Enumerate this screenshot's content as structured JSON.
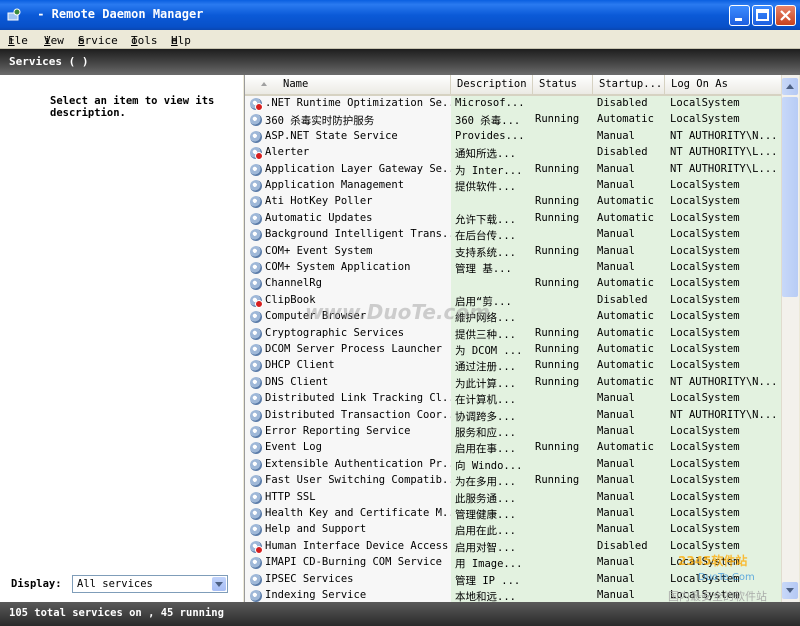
{
  "window": {
    "title": " - Remote Daemon Manager",
    "icon": "app-icon"
  },
  "menu": [
    {
      "u": "F",
      "rest": "ile"
    },
    {
      "u": "V",
      "rest": "iew"
    },
    {
      "u": "S",
      "rest": "ervice"
    },
    {
      "u": "T",
      "rest": "ools"
    },
    {
      "u": "H",
      "rest": "elp"
    }
  ],
  "banner": {
    "title": "Services ( )"
  },
  "left": {
    "description": "Select an item to view its description.",
    "display_label": "Display:",
    "display_value": "All services"
  },
  "columns": [
    "Name",
    "Description",
    "Status",
    "Startup...",
    "Log On As"
  ],
  "rows": [
    {
      "icon": "stop",
      "name": ".NET Runtime Optimization Se...",
      "desc": "Microsof...",
      "status": "",
      "startup": "Disabled",
      "logon": "LocalSystem"
    },
    {
      "icon": "gear",
      "name": "360 杀毒实时防护服务",
      "desc": "360 杀毒...",
      "status": "Running",
      "startup": "Automatic",
      "logon": "LocalSystem"
    },
    {
      "icon": "gear",
      "name": "ASP.NET State Service",
      "desc": "Provides...",
      "status": "",
      "startup": "Manual",
      "logon": "NT AUTHORITY\\N..."
    },
    {
      "icon": "stop",
      "name": "Alerter",
      "desc": "通知所选...",
      "status": "",
      "startup": "Disabled",
      "logon": "NT AUTHORITY\\L..."
    },
    {
      "icon": "gear",
      "name": "Application Layer Gateway Se...",
      "desc": "为 Inter...",
      "status": "Running",
      "startup": "Manual",
      "logon": "NT AUTHORITY\\L..."
    },
    {
      "icon": "gear",
      "name": "Application Management",
      "desc": "提供软件...",
      "status": "",
      "startup": "Manual",
      "logon": "LocalSystem"
    },
    {
      "icon": "gear",
      "name": "Ati HotKey Poller",
      "desc": "",
      "status": "Running",
      "startup": "Automatic",
      "logon": "LocalSystem"
    },
    {
      "icon": "gear",
      "name": "Automatic Updates",
      "desc": "允许下载...",
      "status": "Running",
      "startup": "Automatic",
      "logon": "LocalSystem"
    },
    {
      "icon": "gear",
      "name": "Background Intelligent Trans...",
      "desc": "在后台传...",
      "status": "",
      "startup": "Manual",
      "logon": "LocalSystem"
    },
    {
      "icon": "gear",
      "name": "COM+ Event System",
      "desc": "支持系统...",
      "status": "Running",
      "startup": "Manual",
      "logon": "LocalSystem"
    },
    {
      "icon": "gear",
      "name": "COM+ System Application",
      "desc": "管理 基...",
      "status": "",
      "startup": "Manual",
      "logon": "LocalSystem"
    },
    {
      "icon": "gear",
      "name": "ChannelRg",
      "desc": "",
      "status": "Running",
      "startup": "Automatic",
      "logon": "LocalSystem"
    },
    {
      "icon": "stop",
      "name": "ClipBook",
      "desc": "启用“剪...",
      "status": "",
      "startup": "Disabled",
      "logon": "LocalSystem"
    },
    {
      "icon": "gear",
      "name": "Computer Browser",
      "desc": "維护网络...",
      "status": "",
      "startup": "Automatic",
      "logon": "LocalSystem"
    },
    {
      "icon": "gear",
      "name": "Cryptographic Services",
      "desc": "提供三种...",
      "status": "Running",
      "startup": "Automatic",
      "logon": "LocalSystem"
    },
    {
      "icon": "gear",
      "name": "DCOM Server Process Launcher",
      "desc": "为 DCOM ...",
      "status": "Running",
      "startup": "Automatic",
      "logon": "LocalSystem"
    },
    {
      "icon": "gear",
      "name": "DHCP Client",
      "desc": "通过注册...",
      "status": "Running",
      "startup": "Automatic",
      "logon": "LocalSystem"
    },
    {
      "icon": "gear",
      "name": "DNS Client",
      "desc": "为此计算...",
      "status": "Running",
      "startup": "Automatic",
      "logon": "NT AUTHORITY\\N..."
    },
    {
      "icon": "gear",
      "name": "Distributed Link Tracking Cl...",
      "desc": "在计算机...",
      "status": "",
      "startup": "Manual",
      "logon": "LocalSystem"
    },
    {
      "icon": "gear",
      "name": "Distributed Transaction Coor...",
      "desc": "协调跨多...",
      "status": "",
      "startup": "Manual",
      "logon": "NT AUTHORITY\\N..."
    },
    {
      "icon": "gear",
      "name": "Error Reporting Service",
      "desc": "服务和应...",
      "status": "",
      "startup": "Manual",
      "logon": "LocalSystem"
    },
    {
      "icon": "gear",
      "name": "Event Log",
      "desc": "启用在事...",
      "status": "Running",
      "startup": "Automatic",
      "logon": "LocalSystem"
    },
    {
      "icon": "gear",
      "name": "Extensible Authentication Pr...",
      "desc": "向 Windo...",
      "status": "",
      "startup": "Manual",
      "logon": "LocalSystem"
    },
    {
      "icon": "gear",
      "name": "Fast User Switching Compatib...",
      "desc": "为在多用...",
      "status": "Running",
      "startup": "Manual",
      "logon": "LocalSystem"
    },
    {
      "icon": "gear",
      "name": "HTTP SSL",
      "desc": "此服务通...",
      "status": "",
      "startup": "Manual",
      "logon": "LocalSystem"
    },
    {
      "icon": "gear",
      "name": "Health Key and Certificate M...",
      "desc": "管理健康...",
      "status": "",
      "startup": "Manual",
      "logon": "LocalSystem"
    },
    {
      "icon": "gear",
      "name": "Help and Support",
      "desc": "启用在此...",
      "status": "",
      "startup": "Manual",
      "logon": "LocalSystem"
    },
    {
      "icon": "stop",
      "name": "Human Interface Device Access",
      "desc": "启用对智...",
      "status": "",
      "startup": "Disabled",
      "logon": "LocalSystem"
    },
    {
      "icon": "gear",
      "name": "IMAPI CD-Burning COM Service",
      "desc": "用 Image...",
      "status": "",
      "startup": "Manual",
      "logon": "LocalSystem"
    },
    {
      "icon": "gear",
      "name": "IPSEC Services",
      "desc": "管理 IP ...",
      "status": "",
      "startup": "Manual",
      "logon": "LocalSystem"
    },
    {
      "icon": "gear",
      "name": "Indexing Service",
      "desc": "本地和远...",
      "status": "",
      "startup": "Manual",
      "logon": "LocalSystem"
    }
  ],
  "status": {
    "text": "105 total services on , 45 running"
  },
  "watermarks": {
    "center": "www.DuoTe.com",
    "corner_line1": "2345软件站",
    "corner_line2": "DuoTe.Com",
    "corner_line3": "国内最安全的软件站"
  }
}
